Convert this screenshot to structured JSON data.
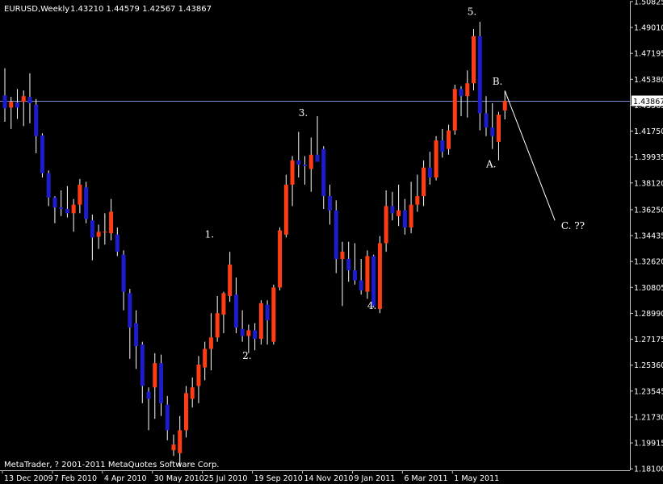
{
  "header": {
    "symbol_timeframe": "EURUSD,Weekly",
    "ohlc": "1.43210 1.44579 1.42567 1.43867"
  },
  "copyright": "MetaTrader, ? 2001-2011 MetaQuotes Software Corp.",
  "colors": {
    "background": "#000000",
    "bull": "#ff3c14",
    "bear": "#1c1ccd",
    "wick": "#ffffff",
    "axis_text": "#ffffff",
    "current_price_line": "#7a8ccf",
    "annotation": "#ffffff"
  },
  "chart_data": {
    "type": "candlestick",
    "title": "EURUSD,Weekly",
    "ylim": [
      1.1811,
      1.5082
    ],
    "y_ticks": [
      "1.50825",
      "1.49010",
      "1.47195",
      "1.45380",
      "1.43565",
      "1.41750",
      "1.39935",
      "1.38120",
      "1.36250",
      "1.34435",
      "1.32620",
      "1.30805",
      "1.28990",
      "1.27175",
      "1.25360",
      "1.23545",
      "1.21730",
      "1.19915",
      "1.18100"
    ],
    "x_ticks": [
      "13 Dec 2009",
      "7 Feb 2010",
      "4 Apr 2010",
      "30 May 2010",
      "25 Jul 2010",
      "19 Sep 2010",
      "14 Nov 2010",
      "9 Jan 2011",
      "6 Mar 2011",
      "1 May 2011"
    ],
    "x_tick_index": [
      0,
      8,
      16,
      24,
      32,
      40,
      48,
      56,
      64,
      72
    ],
    "current_price": 1.43867,
    "current_price_label": "1.43867",
    "candles": [
      {
        "o": 1.4425,
        "h": 1.4615,
        "l": 1.424,
        "c": 1.4335
      },
      {
        "o": 1.434,
        "h": 1.4415,
        "l": 1.419,
        "c": 1.438
      },
      {
        "o": 1.4375,
        "h": 1.447,
        "l": 1.426,
        "c": 1.434
      },
      {
        "o": 1.438,
        "h": 1.446,
        "l": 1.421,
        "c": 1.442
      },
      {
        "o": 1.4415,
        "h": 1.458,
        "l": 1.423,
        "c": 1.437
      },
      {
        "o": 1.436,
        "h": 1.44,
        "l": 1.402,
        "c": 1.414
      },
      {
        "o": 1.4145,
        "h": 1.416,
        "l": 1.385,
        "c": 1.388
      },
      {
        "o": 1.388,
        "h": 1.39,
        "l": 1.365,
        "c": 1.371
      },
      {
        "o": 1.371,
        "h": 1.372,
        "l": 1.353,
        "c": 1.364
      },
      {
        "o": 1.364,
        "h": 1.376,
        "l": 1.358,
        "c": 1.363
      },
      {
        "o": 1.363,
        "h": 1.379,
        "l": 1.357,
        "c": 1.36
      },
      {
        "o": 1.36,
        "h": 1.37,
        "l": 1.347,
        "c": 1.366
      },
      {
        "o": 1.366,
        "h": 1.384,
        "l": 1.36,
        "c": 1.38
      },
      {
        "o": 1.378,
        "h": 1.382,
        "l": 1.353,
        "c": 1.356
      },
      {
        "o": 1.355,
        "h": 1.359,
        "l": 1.327,
        "c": 1.343
      },
      {
        "o": 1.3435,
        "h": 1.352,
        "l": 1.335,
        "c": 1.347
      },
      {
        "o": 1.3465,
        "h": 1.36,
        "l": 1.338,
        "c": 1.347
      },
      {
        "o": 1.346,
        "h": 1.37,
        "l": 1.341,
        "c": 1.361
      },
      {
        "o": 1.345,
        "h": 1.35,
        "l": 1.33,
        "c": 1.333
      },
      {
        "o": 1.331,
        "h": 1.334,
        "l": 1.292,
        "c": 1.305
      },
      {
        "o": 1.304,
        "h": 1.307,
        "l": 1.258,
        "c": 1.28
      },
      {
        "o": 1.283,
        "h": 1.292,
        "l": 1.251,
        "c": 1.267
      },
      {
        "o": 1.268,
        "h": 1.27,
        "l": 1.227,
        "c": 1.239
      },
      {
        "o": 1.235,
        "h": 1.238,
        "l": 1.208,
        "c": 1.23
      },
      {
        "o": 1.238,
        "h": 1.262,
        "l": 1.216,
        "c": 1.255
      },
      {
        "o": 1.255,
        "h": 1.261,
        "l": 1.218,
        "c": 1.227
      },
      {
        "o": 1.226,
        "h": 1.232,
        "l": 1.201,
        "c": 1.208
      },
      {
        "o": 1.194,
        "h": 1.205,
        "l": 1.19,
        "c": 1.198
      },
      {
        "o": 1.192,
        "h": 1.218,
        "l": 1.183,
        "c": 1.208
      },
      {
        "o": 1.208,
        "h": 1.239,
        "l": 1.203,
        "c": 1.234
      },
      {
        "o": 1.23,
        "h": 1.245,
        "l": 1.224,
        "c": 1.238
      },
      {
        "o": 1.239,
        "h": 1.26,
        "l": 1.227,
        "c": 1.254
      },
      {
        "o": 1.252,
        "h": 1.27,
        "l": 1.243,
        "c": 1.265
      },
      {
        "o": 1.265,
        "h": 1.29,
        "l": 1.25,
        "c": 1.273
      },
      {
        "o": 1.273,
        "h": 1.302,
        "l": 1.27,
        "c": 1.29
      },
      {
        "o": 1.289,
        "h": 1.305,
        "l": 1.276,
        "c": 1.304
      },
      {
        "o": 1.302,
        "h": 1.333,
        "l": 1.298,
        "c": 1.324
      },
      {
        "o": 1.303,
        "h": 1.315,
        "l": 1.276,
        "c": 1.28
      },
      {
        "o": 1.279,
        "h": 1.292,
        "l": 1.27,
        "c": 1.274
      },
      {
        "o": 1.274,
        "h": 1.282,
        "l": 1.262,
        "c": 1.278
      },
      {
        "o": 1.278,
        "h": 1.283,
        "l": 1.264,
        "c": 1.272
      },
      {
        "o": 1.272,
        "h": 1.299,
        "l": 1.268,
        "c": 1.297
      },
      {
        "o": 1.296,
        "h": 1.299,
        "l": 1.268,
        "c": 1.285
      },
      {
        "o": 1.27,
        "h": 1.31,
        "l": 1.268,
        "c": 1.308
      },
      {
        "o": 1.308,
        "h": 1.35,
        "l": 1.306,
        "c": 1.348
      },
      {
        "o": 1.345,
        "h": 1.387,
        "l": 1.343,
        "c": 1.38
      },
      {
        "o": 1.38,
        "h": 1.4,
        "l": 1.365,
        "c": 1.397
      },
      {
        "o": 1.397,
        "h": 1.417,
        "l": 1.385,
        "c": 1.394
      },
      {
        "o": 1.394,
        "h": 1.4,
        "l": 1.38,
        "c": 1.393
      },
      {
        "o": 1.391,
        "h": 1.413,
        "l": 1.375,
        "c": 1.401
      },
      {
        "o": 1.401,
        "h": 1.428,
        "l": 1.398,
        "c": 1.396
      },
      {
        "o": 1.405,
        "h": 1.407,
        "l": 1.363,
        "c": 1.372
      },
      {
        "o": 1.372,
        "h": 1.38,
        "l": 1.352,
        "c": 1.362
      },
      {
        "o": 1.362,
        "h": 1.369,
        "l": 1.318,
        "c": 1.328
      },
      {
        "o": 1.328,
        "h": 1.34,
        "l": 1.295,
        "c": 1.333
      },
      {
        "o": 1.328,
        "h": 1.34,
        "l": 1.312,
        "c": 1.32
      },
      {
        "o": 1.32,
        "h": 1.339,
        "l": 1.31,
        "c": 1.313
      },
      {
        "o": 1.313,
        "h": 1.328,
        "l": 1.303,
        "c": 1.306
      },
      {
        "o": 1.305,
        "h": 1.334,
        "l": 1.3,
        "c": 1.33
      },
      {
        "o": 1.33,
        "h": 1.331,
        "l": 1.294,
        "c": 1.295
      },
      {
        "o": 1.293,
        "h": 1.344,
        "l": 1.29,
        "c": 1.339
      },
      {
        "o": 1.339,
        "h": 1.376,
        "l": 1.333,
        "c": 1.365
      },
      {
        "o": 1.365,
        "h": 1.375,
        "l": 1.355,
        "c": 1.36
      },
      {
        "o": 1.358,
        "h": 1.38,
        "l": 1.351,
        "c": 1.362
      },
      {
        "o": 1.362,
        "h": 1.37,
        "l": 1.345,
        "c": 1.35
      },
      {
        "o": 1.35,
        "h": 1.382,
        "l": 1.346,
        "c": 1.366
      },
      {
        "o": 1.366,
        "h": 1.387,
        "l": 1.361,
        "c": 1.372
      },
      {
        "o": 1.372,
        "h": 1.397,
        "l": 1.365,
        "c": 1.392
      },
      {
        "o": 1.392,
        "h": 1.403,
        "l": 1.38,
        "c": 1.385
      },
      {
        "o": 1.385,
        "h": 1.414,
        "l": 1.383,
        "c": 1.411
      },
      {
        "o": 1.411,
        "h": 1.419,
        "l": 1.399,
        "c": 1.403
      },
      {
        "o": 1.405,
        "h": 1.422,
        "l": 1.401,
        "c": 1.418
      },
      {
        "o": 1.418,
        "h": 1.45,
        "l": 1.415,
        "c": 1.447
      },
      {
        "o": 1.447,
        "h": 1.449,
        "l": 1.428,
        "c": 1.442
      },
      {
        "o": 1.442,
        "h": 1.46,
        "l": 1.427,
        "c": 1.451
      },
      {
        "o": 1.451,
        "h": 1.489,
        "l": 1.446,
        "c": 1.484
      },
      {
        "o": 1.484,
        "h": 1.494,
        "l": 1.418,
        "c": 1.43
      },
      {
        "o": 1.43,
        "h": 1.442,
        "l": 1.414,
        "c": 1.42
      },
      {
        "o": 1.42,
        "h": 1.437,
        "l": 1.405,
        "c": 1.414
      },
      {
        "o": 1.41,
        "h": 1.431,
        "l": 1.397,
        "c": 1.429
      },
      {
        "o": 1.432,
        "h": 1.4458,
        "l": 1.4257,
        "c": 1.4387
      }
    ],
    "annotations": [
      {
        "text": "1.",
        "x": 32,
        "y": 1.343
      },
      {
        "text": "2.",
        "x": 38,
        "y": 1.258
      },
      {
        "text": "3.",
        "x": 47,
        "y": 1.428
      },
      {
        "text": "4.",
        "x": 58,
        "y": 1.293
      },
      {
        "text": "5.",
        "x": 74,
        "y": 1.499
      },
      {
        "text": "A.",
        "x": 77,
        "y": 1.392
      },
      {
        "text": "B.",
        "x": 78,
        "y": 1.45
      },
      {
        "text": "C.  ??",
        "x": 89,
        "y": 1.349
      }
    ],
    "projection": {
      "from": {
        "x": 80,
        "y": 1.4458
      },
      "to": {
        "x": 88,
        "y": 1.355
      }
    }
  }
}
